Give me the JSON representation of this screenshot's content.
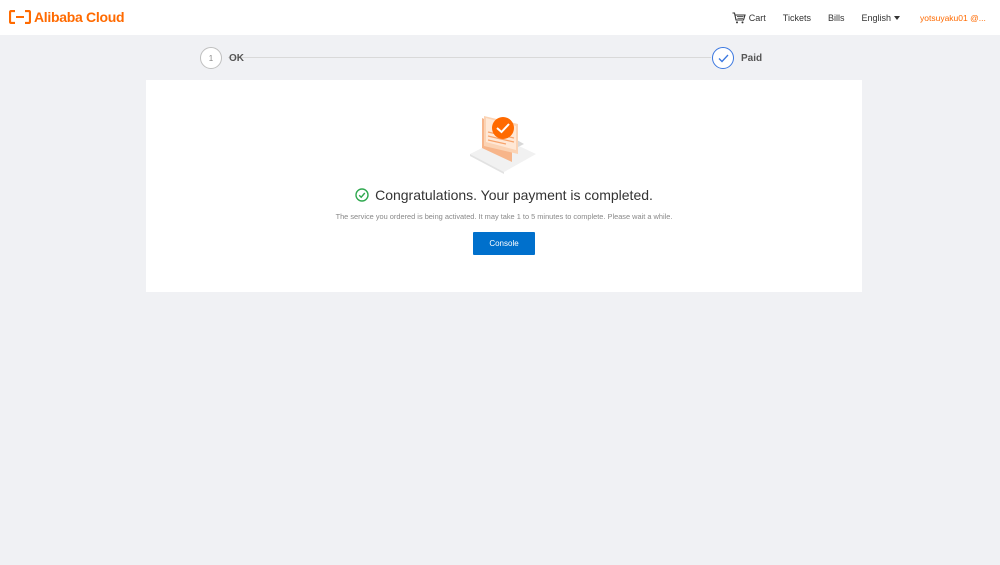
{
  "brand": {
    "logo_text": "Alibaba Cloud",
    "color": "#ff6a00"
  },
  "nav": {
    "cart": "Cart",
    "tickets": "Tickets",
    "bills": "Bills",
    "language": "English",
    "user": "yotsuyaku01 @..."
  },
  "steps": [
    {
      "number": "1",
      "label": "OK",
      "state": "done"
    },
    {
      "number": "",
      "label": "Paid",
      "state": "current",
      "icon": "check-icon"
    }
  ],
  "result": {
    "title": "Congratulations. Your payment is completed.",
    "message": "The service you ordered is being activated. It may take 1 to 5 minutes to complete. Please wait a while.",
    "button": "Console",
    "success_color": "#2fa84f",
    "button_color": "#0070cc"
  }
}
